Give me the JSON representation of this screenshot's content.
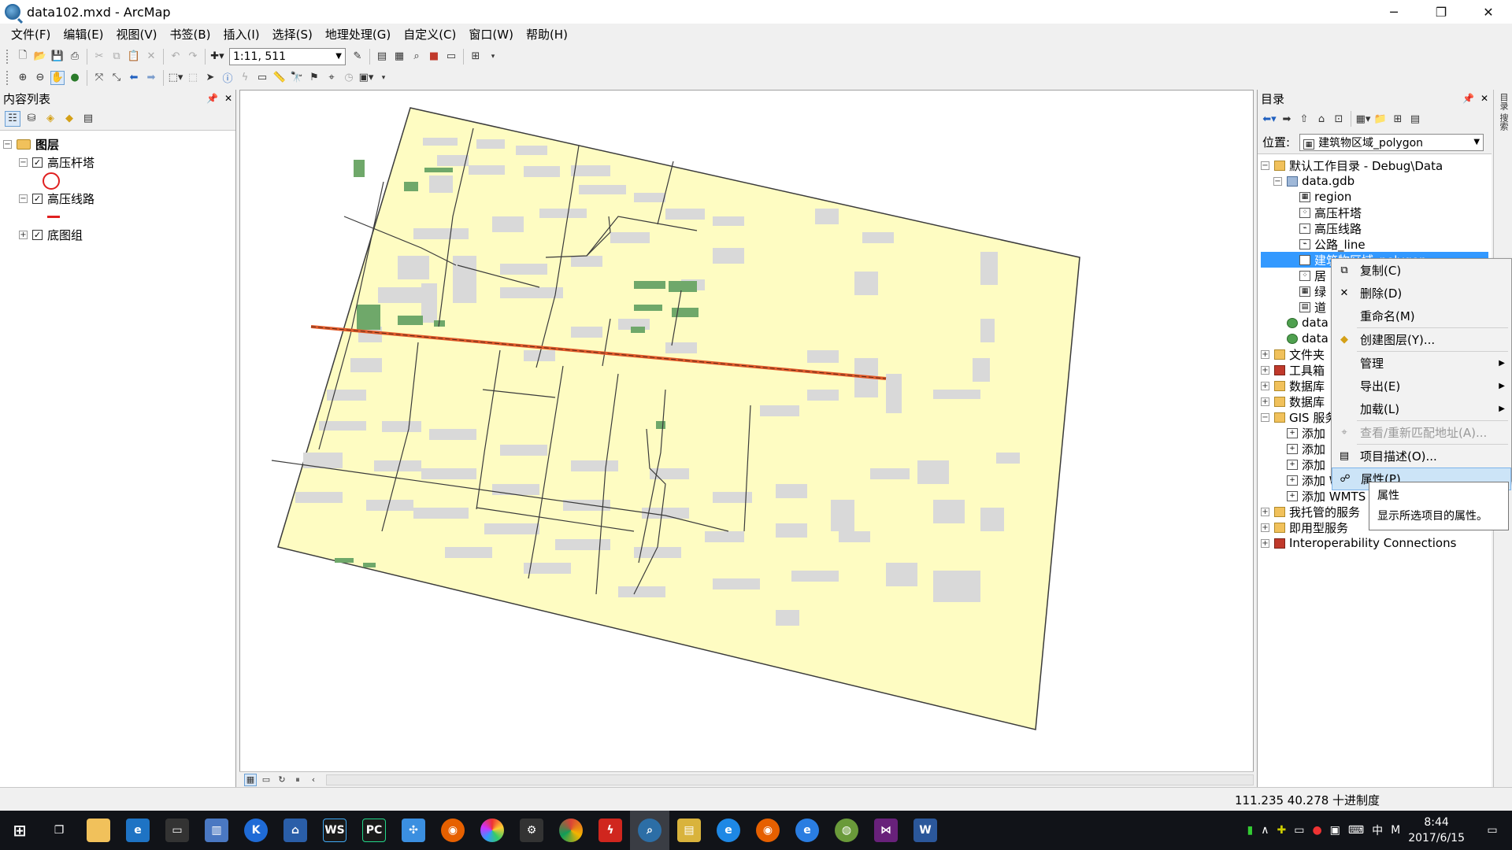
{
  "window": {
    "title": "data102.mxd - ArcMap",
    "minimize": "─",
    "restore": "❐",
    "close": "✕"
  },
  "menu": [
    "文件(F)",
    "编辑(E)",
    "视图(V)",
    "书签(B)",
    "插入(I)",
    "选择(S)",
    "地理处理(G)",
    "自定义(C)",
    "窗口(W)",
    "帮助(H)"
  ],
  "toolbar": {
    "scale": "1:11, 511"
  },
  "toc": {
    "title": "内容列表",
    "root": "图层",
    "layers": [
      {
        "name": "高压杆塔",
        "checked": true
      },
      {
        "name": "高压线路",
        "checked": true
      },
      {
        "name": "底图组",
        "checked": true
      }
    ]
  },
  "catalog": {
    "title": "目录",
    "location_label": "位置:",
    "location_value": "建筑物区域_polygon",
    "items": [
      {
        "label": "默认工作目录 - Debug\\Data",
        "icon": "folder"
      },
      {
        "label": "data.gdb",
        "icon": "gdb"
      },
      {
        "label": "region",
        "icon": "polygon"
      },
      {
        "label": "高压杆塔",
        "icon": "point"
      },
      {
        "label": "高压线路",
        "icon": "line"
      },
      {
        "label": "公路_line",
        "icon": "line"
      },
      {
        "label": "建筑物区域_polygon",
        "icon": "polygon"
      },
      {
        "label": "居",
        "icon": "point"
      },
      {
        "label": "绿",
        "icon": "polygon"
      },
      {
        "label": "道",
        "icon": "table"
      },
      {
        "label": "data",
        "icon": "globe"
      },
      {
        "label": "data",
        "icon": "globe"
      },
      {
        "label": "文件夹",
        "icon": "folder"
      },
      {
        "label": "工具箱",
        "icon": "tool"
      },
      {
        "label": "数据库",
        "icon": "folder"
      },
      {
        "label": "数据库",
        "icon": "folder"
      },
      {
        "label": "GIS 服务",
        "icon": "folder"
      },
      {
        "label": "添加",
        "icon": "add"
      },
      {
        "label": "添加",
        "icon": "add"
      },
      {
        "label": "添加",
        "icon": "add"
      },
      {
        "label": "添加 WMS 服务",
        "icon": "add"
      },
      {
        "label": "添加 WMTS",
        "icon": "add"
      },
      {
        "label": "我托管的服务",
        "icon": "folder"
      },
      {
        "label": "即用型服务",
        "icon": "folder"
      },
      {
        "label": "Interoperability Connections",
        "icon": "tool"
      }
    ]
  },
  "context_menu": [
    {
      "label": "复制(C)",
      "icon": "copy-icon"
    },
    {
      "label": "删除(D)",
      "icon": "delete-icon"
    },
    {
      "label": "重命名(M)",
      "icon": ""
    },
    {
      "label": "创建图层(Y)...",
      "icon": "layer-icon"
    },
    {
      "label": "管理",
      "icon": "",
      "submenu": true
    },
    {
      "label": "导出(E)",
      "icon": "",
      "submenu": true
    },
    {
      "label": "加载(L)",
      "icon": "",
      "submenu": true
    },
    {
      "label": "查看/重新匹配地址(A)...",
      "icon": "address-icon",
      "disabled": true
    },
    {
      "label": "项目描述(O)...",
      "icon": "description-icon"
    },
    {
      "label": "属性(P)...",
      "icon": "properties-icon",
      "hover": true
    }
  ],
  "tooltip": {
    "title": "属性",
    "text": "显示所选项目的属性。"
  },
  "status": {
    "coords": "111.235  40.278 十进制度"
  },
  "taskbar": {
    "time": "8:44",
    "date": "2017/6/15",
    "ime": "中",
    "ime2": "M"
  },
  "colors": {
    "map_fill": "#fefcc2",
    "building": "#d9d9d9",
    "green": "#6fa86a",
    "road": "#3a3a3a",
    "powerline": "#e05a2a",
    "selection": "#3399ff"
  }
}
